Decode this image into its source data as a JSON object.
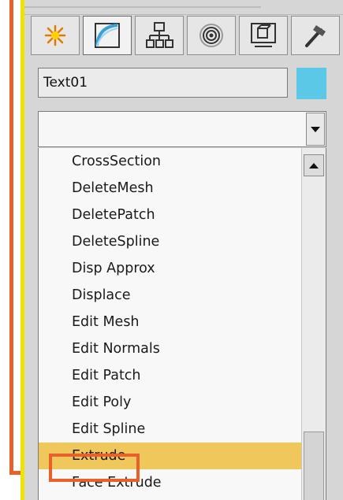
{
  "panel": {
    "tabs": [
      {
        "icon": "create-icon",
        "active": false
      },
      {
        "icon": "modify-icon",
        "active": true
      },
      {
        "icon": "hierarchy-icon",
        "active": false
      },
      {
        "icon": "motion-icon",
        "active": false
      },
      {
        "icon": "display-icon",
        "active": false
      },
      {
        "icon": "utilities-icon",
        "active": false
      }
    ],
    "object_name": "Text01",
    "object_color": "#5bc8e8",
    "modifier_list_value": ""
  },
  "modifier_list": {
    "items": [
      "CrossSection",
      "DeleteMesh",
      "DeletePatch",
      "DeleteSpline",
      "Disp Approx",
      "Displace",
      "Edit Mesh",
      "Edit Normals",
      "Edit Patch",
      "Edit Poly",
      "Edit Spline",
      "Extrude",
      "Face Extrude"
    ],
    "selected": "Extrude",
    "highlight_color": "#f0c75a"
  },
  "annotation": {
    "callout_color": "#e8602a",
    "bar_color": "#f2e200"
  }
}
